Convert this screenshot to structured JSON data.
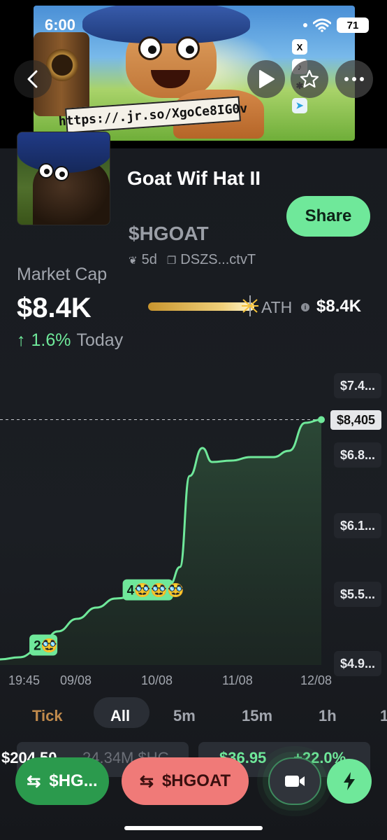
{
  "status_bar": {
    "time": "6:00",
    "battery": "71"
  },
  "banner": {
    "url_sign": "https://.jr.so/XgoCe8IG0v",
    "social_icons": [
      "x-icon",
      "tiktok-icon",
      "link-icon",
      "telegram-icon"
    ]
  },
  "token": {
    "name": "Goat Wif Hat II",
    "ticker": "$HGOAT",
    "age": "5d",
    "address": "DSZS...ctvT",
    "share_label": "Share"
  },
  "market": {
    "label": "Market Cap",
    "value": "$8.4K",
    "change_value": "1.6%",
    "change_period": "Today",
    "ath_label": "ATH",
    "ath_value": "$8.4K",
    "ath_progress": 0.98
  },
  "chart_data": {
    "type": "area",
    "title": "",
    "xlabel": "",
    "ylabel": "",
    "x_ticks": [
      "19:45",
      "09/08",
      "10/08",
      "11/08",
      "12/08"
    ],
    "y_ticks": [
      "$7.4...",
      "$6.8...",
      "$6.1...",
      "$5.5...",
      "$4.9..."
    ],
    "current_price_label": "$8,405",
    "points": [
      {
        "x": 0,
        "y": 4980
      },
      {
        "x": 0.06,
        "y": 5010
      },
      {
        "x": 0.12,
        "y": 5120
      },
      {
        "x": 0.18,
        "y": 5380
      },
      {
        "x": 0.24,
        "y": 5560
      },
      {
        "x": 0.3,
        "y": 5720
      },
      {
        "x": 0.36,
        "y": 5850
      },
      {
        "x": 0.42,
        "y": 5880
      },
      {
        "x": 0.48,
        "y": 6020
      },
      {
        "x": 0.53,
        "y": 6060
      },
      {
        "x": 0.56,
        "y": 6300
      },
      {
        "x": 0.59,
        "y": 7600
      },
      {
        "x": 0.63,
        "y": 8000
      },
      {
        "x": 0.66,
        "y": 7800
      },
      {
        "x": 0.72,
        "y": 7820
      },
      {
        "x": 0.78,
        "y": 7870
      },
      {
        "x": 0.85,
        "y": 7870
      },
      {
        "x": 0.9,
        "y": 7960
      },
      {
        "x": 0.95,
        "y": 8360
      },
      {
        "x": 1.0,
        "y": 8405
      }
    ],
    "markers": [
      {
        "label": "2",
        "emoji": "🥸",
        "x": 0.135
      },
      {
        "label": "4",
        "emoji": "🥸🥸🥸",
        "x": 0.46
      }
    ],
    "line_color": "#6fe89a",
    "fill_color": "#2a4a36"
  },
  "intervals": [
    "Tick",
    "All",
    "5m",
    "15m",
    "1h",
    "1"
  ],
  "selected_interval": "All",
  "trade_row": {
    "left_value": "$204.50",
    "left_amount": "24.34M $HG",
    "right_value": "$36.95",
    "right_change": "+22.0%"
  },
  "actions": {
    "buy_label": "$HG...",
    "sell_label": "$HGOAT"
  },
  "colors": {
    "accent_green": "#6fe89a",
    "sell_red": "#f07a78",
    "buy_green": "#2b9a4d",
    "background": "#1b1e23"
  }
}
